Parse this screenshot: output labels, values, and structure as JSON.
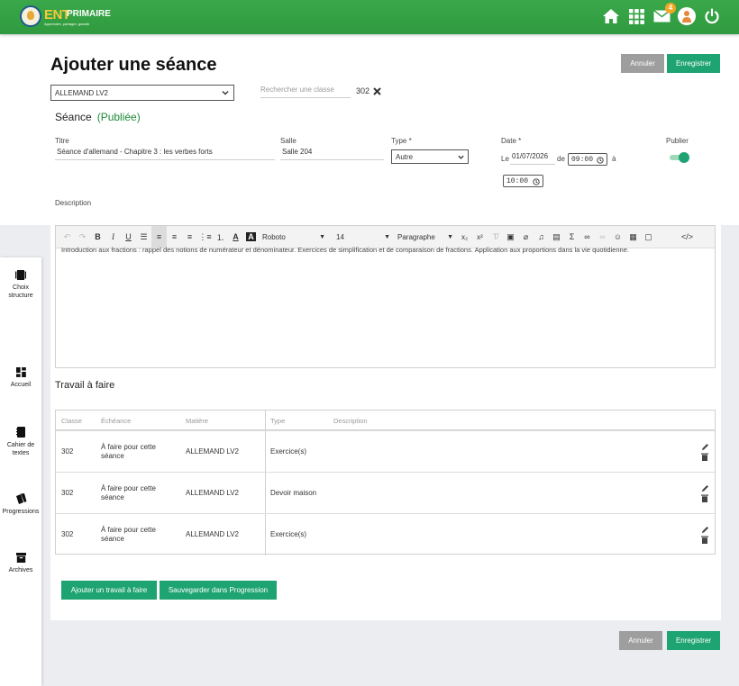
{
  "app": {
    "logo_ent": "ENT",
    "logo_primaire": "PRIMAIRE",
    "logo_tagline": "Apprendre, partager, grandir",
    "mail_badge": "4"
  },
  "page": {
    "title": "Ajouter une séance",
    "cancel_label": "Annuler",
    "save_label": "Enregistrer"
  },
  "filters": {
    "subject": "ALLEMAND LV2",
    "search_placeholder": "Rechercher une classe",
    "class_tag": "302"
  },
  "seance": {
    "heading": "Séance",
    "status": "(Publiée)",
    "title_label": "Titre",
    "title_value": "Séance d'allemand - Chapitre 3 : les verbes forts",
    "room_label": "Salle",
    "room_value": "Salle 204",
    "type_label": "Type *",
    "type_value": "Autre",
    "date_label": "Date *",
    "date_prefix": "Le",
    "date_value": "01/07/2026",
    "from_label": "de",
    "start_time": "09:00",
    "to_label": "à",
    "end_time": "10:00",
    "publish_label": "Publier",
    "published": true,
    "description_label": "Description"
  },
  "editor": {
    "font": "Roboto",
    "size": "14",
    "block": "Paragraphe",
    "content": "Introduction aux fractions : rappel des notions de numérateur et dénominateur. Exercices de simplification et de comparaison de fractions. Application aux proportions dans la vie quotidienne."
  },
  "homework": {
    "title": "Travail à faire",
    "columns": [
      "Classe",
      "Échéance",
      "Matière",
      "Type",
      "Description"
    ],
    "rows": [
      {
        "classe": "302",
        "echeance_1": "À faire pour cette",
        "echeance_2": "séance",
        "matiere": "ALLEMAND LV2",
        "type": "Exercice(s)"
      },
      {
        "classe": "302",
        "echeance_1": "À faire pour cette",
        "echeance_2": "séance",
        "matiere": "ALLEMAND LV2",
        "type": "Devoir maison"
      },
      {
        "classe": "302",
        "echeance_1": "À faire pour cette",
        "echeance_2": "séance",
        "matiere": "ALLEMAND LV2",
        "type": "Exercice(s)"
      }
    ],
    "add_label": "Ajouter un travail à faire",
    "save_progression_label": "Sauvegarder dans Progression"
  },
  "sidebar": {
    "items": [
      {
        "label_1": "Choix",
        "label_2": "structure"
      },
      {
        "label_1": "Accueil",
        "label_2": ""
      },
      {
        "label_1": "Cahier de",
        "label_2": "textes"
      },
      {
        "label_1": "Progressions",
        "label_2": ""
      },
      {
        "label_1": "Archives",
        "label_2": ""
      }
    ]
  },
  "colors": {
    "brand_green": "#2f9a3f",
    "accent": "#1ea373",
    "status_published": "#1e8a3a"
  }
}
